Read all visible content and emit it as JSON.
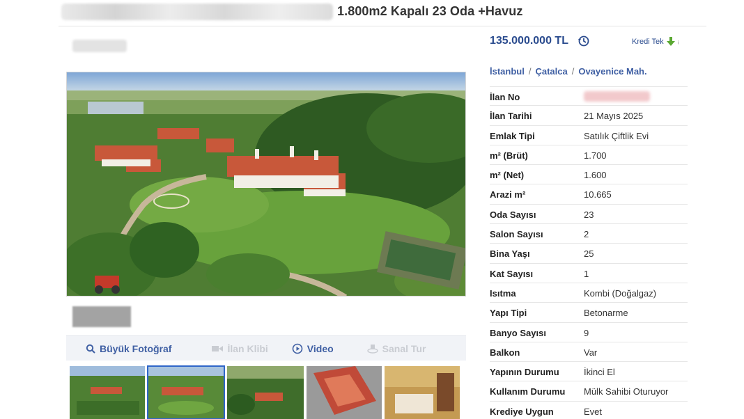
{
  "header": {
    "title": "1.800m2 Kapalı 23 Oda +Havuz"
  },
  "price": {
    "amount": "135.000.000 TL",
    "credit_label": "Kredi Tek"
  },
  "breadcrumb": {
    "city": "İstanbul",
    "district": "Çatalca",
    "neighborhood": "Ovayenice Mah."
  },
  "media_bar": {
    "big_photo": "Büyük Fotoğraf",
    "listing_clip": "İlan Klibi",
    "video": "Video",
    "virtual_tour": "Sanal Tur"
  },
  "details": [
    {
      "label": "İlan No",
      "value": ""
    },
    {
      "label": "İlan Tarihi",
      "value": "21 Mayıs 2025"
    },
    {
      "label": "Emlak Tipi",
      "value": "Satılık Çiftlik Evi"
    },
    {
      "label": "m² (Brüt)",
      "value": "1.700"
    },
    {
      "label": "m² (Net)",
      "value": "1.600"
    },
    {
      "label": "Arazi m²",
      "value": "10.665"
    },
    {
      "label": "Oda Sayısı",
      "value": "23"
    },
    {
      "label": "Salon Sayısı",
      "value": "2"
    },
    {
      "label": "Bina Yaşı",
      "value": "25"
    },
    {
      "label": "Kat Sayısı",
      "value": "1"
    },
    {
      "label": "Isıtma",
      "value": "Kombi (Doğalgaz)"
    },
    {
      "label": "Yapı Tipi",
      "value": "Betonarme"
    },
    {
      "label": "Banyo Sayısı",
      "value": "9"
    },
    {
      "label": "Balkon",
      "value": "Var"
    },
    {
      "label": "Yapının Durumu",
      "value": "İkinci El"
    },
    {
      "label": "Kullanım Durumu",
      "value": "Mülk Sahibi Oturuyor"
    },
    {
      "label": "Krediye Uygun",
      "value": "Evet"
    }
  ],
  "colors": {
    "link": "#2a4b8e",
    "accent": "#3f5fa3",
    "download_arrow": "#5aa832",
    "selected_thumb": "#2f66c9"
  },
  "icons": {
    "history": "history-icon",
    "download": "download-arrow-icon",
    "search": "search-icon",
    "video": "play-circle-icon",
    "camera": "video-camera-icon",
    "tour": "virtual-tour-icon"
  },
  "thumbnails": {
    "selected_index": 1,
    "count": 5
  }
}
